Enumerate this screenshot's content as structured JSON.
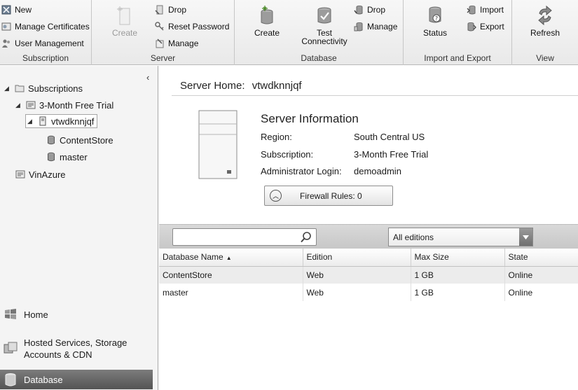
{
  "ribbon": {
    "subscription": {
      "label": "Subscription",
      "new": "New",
      "manage_certificates": "Manage Certificates",
      "user_management": "User Management"
    },
    "server": {
      "label": "Server",
      "create": "Create",
      "drop": "Drop",
      "reset_password": "Reset Password",
      "manage": "Manage"
    },
    "database": {
      "label": "Database",
      "create": "Create",
      "test_connectivity": "Test Connectivity",
      "drop": "Drop",
      "manage": "Manage"
    },
    "import_export": {
      "label": "Import and Export",
      "status": "Status",
      "import": "Import",
      "export": "Export"
    },
    "view": {
      "label": "View",
      "refresh": "Refresh"
    }
  },
  "nav": {
    "tree": [
      {
        "label": "Subscriptions"
      },
      {
        "label": "3-Month Free Trial"
      },
      {
        "label": "vtwdknnjqf"
      },
      {
        "label": "ContentStore"
      },
      {
        "label": "master"
      },
      {
        "label": "VinAzure"
      }
    ],
    "sections": [
      {
        "label": "Home"
      },
      {
        "label": "Hosted Services, Storage Accounts & CDN"
      },
      {
        "label": "Database"
      }
    ]
  },
  "server_home": {
    "title_prefix": "Server Home:",
    "server_name": "vtwdknnjqf",
    "info_heading": "Server Information",
    "info": [
      {
        "key": "Region:",
        "value": "South Central US"
      },
      {
        "key": "Subscription:",
        "value": "3-Month Free Trial"
      },
      {
        "key": "Administrator Login:",
        "value": "demoadmin"
      }
    ],
    "firewall_label": "Firewall Rules: 0"
  },
  "filter": {
    "search_value": "",
    "edition_selected": "All editions"
  },
  "table": {
    "columns": [
      "Database Name",
      "Edition",
      "Max Size",
      "State"
    ],
    "rows": [
      [
        "ContentStore",
        "Web",
        "1 GB",
        "Online"
      ],
      [
        "master",
        "Web",
        "1 GB",
        "Online"
      ]
    ]
  }
}
